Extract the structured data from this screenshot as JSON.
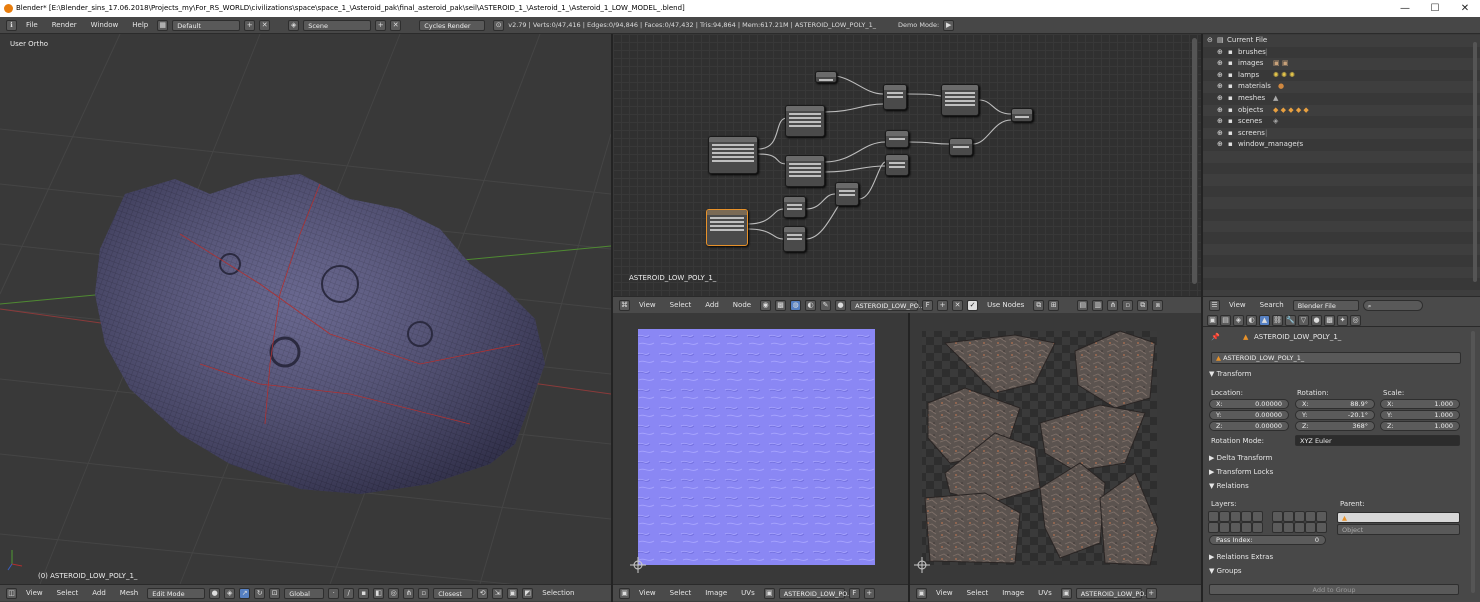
{
  "window": {
    "title": "Blender* [E:\\Blender_sins_17.06.2018\\Projects_my\\For_RS_WORLD\\civilizations\\space\\space_1_\\Asteroid_pak\\final_asteroid_pak\\seil\\ASTEROID_1_\\Asteroid_1_\\Asteroid_1_LOW_MODEL_.blend]",
    "minimize": "—",
    "maximize": "☐",
    "close": "✕"
  },
  "info_header": {
    "menus": [
      "File",
      "Render",
      "Window",
      "Help"
    ],
    "layout": "Default",
    "scene": "Scene",
    "engine": "Cycles Render",
    "stats": "v2.79 | Verts:0/47,416 | Edges:0/94,846 | Faces:0/47,432 | Tris:94,864 | Mem:617.21M | ASTEROID_LOW_POLY_1_",
    "demo_mode": "Demo Mode:"
  },
  "viewport3d": {
    "view_label": "User Ortho",
    "object_label": "(0) ASTEROID_LOW_POLY_1_",
    "header": {
      "menus": [
        "View",
        "Select",
        "Add",
        "Mesh"
      ],
      "mode": "Edit Mode",
      "orientation": "Global",
      "snap_target": "Closest",
      "selection_label": "Selection"
    }
  },
  "node_editor": {
    "material_label": "ASTEROID_LOW_POLY_1_",
    "header": {
      "menus": [
        "View",
        "Select",
        "Add",
        "Node"
      ],
      "material": "ASTEROID_LOW_PO...",
      "fake_user": "F",
      "use_nodes": "Use Nodes"
    }
  },
  "outliner": {
    "root": "Current File",
    "items": [
      "brushes",
      "images",
      "lamps",
      "materials",
      "meshes",
      "objects",
      "scenes",
      "screens",
      "window_managers"
    ],
    "header": {
      "menus": [
        "View",
        "Search"
      ],
      "display_mode": "Blender File"
    }
  },
  "uv_editor_1": {
    "header": {
      "menus": [
        "View",
        "Select",
        "Image",
        "UVs"
      ],
      "image": "ASTEROID_LOW_PO...",
      "fake_user": "F"
    }
  },
  "uv_editor_2": {
    "header": {
      "menus": [
        "View",
        "Select",
        "Image",
        "UVs"
      ],
      "image": "ASTEROID_LOW_PO..."
    }
  },
  "properties": {
    "breadcrumb": "ASTEROID_LOW_POLY_1_",
    "object_name": "ASTEROID_LOW_POLY_1_",
    "transform_label": "Transform",
    "location_label": "Location:",
    "rotation_label": "Rotation:",
    "scale_label": "Scale:",
    "location": [
      {
        "axis": "X:",
        "value": "0.00000"
      },
      {
        "axis": "Y:",
        "value": "0.00000"
      },
      {
        "axis": "Z:",
        "value": "0.00000"
      }
    ],
    "rotation": [
      {
        "axis": "X:",
        "value": "88.9°"
      },
      {
        "axis": "Y:",
        "value": "-20.1°"
      },
      {
        "axis": "Z:",
        "value": "368°"
      }
    ],
    "scale": [
      {
        "axis": "X:",
        "value": "1.000"
      },
      {
        "axis": "Y:",
        "value": "1.000"
      },
      {
        "axis": "Z:",
        "value": "1.000"
      }
    ],
    "rotation_mode_label": "Rotation Mode:",
    "rotation_mode": "XYZ Euler",
    "delta_transform": "Delta Transform",
    "transform_locks": "Transform Locks",
    "relations": "Relations",
    "layers_label": "Layers:",
    "parent_label": "Parent:",
    "parent_type": "Object",
    "pass_index_label": "Pass Index:",
    "pass_index": "0",
    "relations_extras": "Relations Extras",
    "groups": "Groups",
    "add_to_group": "Add to Group"
  },
  "colors": {
    "accent_orange": "#e8922a",
    "selected_blue": "#5680c2",
    "mesh_wire": "#4a4a6e",
    "normal_map": "#8080ff"
  }
}
